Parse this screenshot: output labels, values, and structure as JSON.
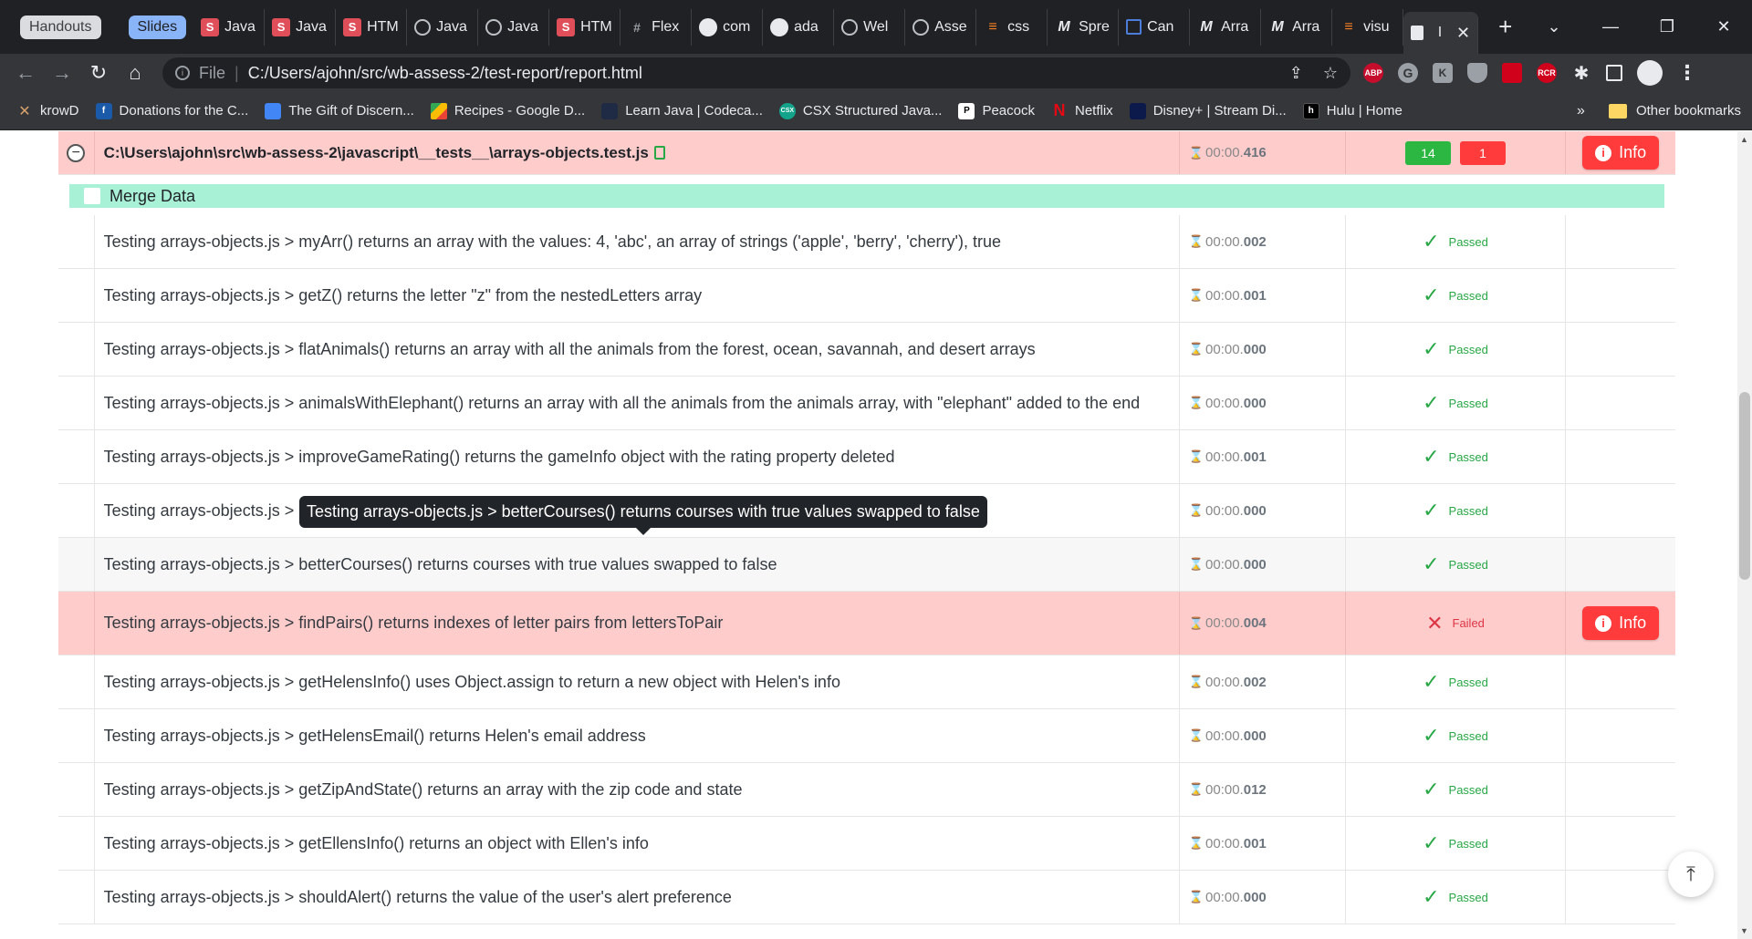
{
  "browser": {
    "tab_groups": [
      "Handouts",
      "Slides"
    ],
    "tabs": [
      {
        "icon": "s-icon",
        "label": "Java"
      },
      {
        "icon": "s-icon",
        "label": "Java"
      },
      {
        "icon": "s-icon",
        "label": "HTM"
      },
      {
        "icon": "globe-icon",
        "label": "Java"
      },
      {
        "icon": "globe-icon",
        "label": "Java"
      },
      {
        "icon": "s-icon",
        "label": "HTM"
      },
      {
        "icon": "flex-icon",
        "label": "Flex"
      },
      {
        "icon": "github-icon",
        "label": "com"
      },
      {
        "icon": "github-icon",
        "label": "ada"
      },
      {
        "icon": "globe-icon",
        "label": "Wel"
      },
      {
        "icon": "globe-icon",
        "label": "Asse"
      },
      {
        "icon": "stackoverflow-icon",
        "label": "css"
      },
      {
        "icon": "mdn-icon",
        "label": "Spre"
      },
      {
        "icon": "canvas-icon",
        "label": "Can"
      },
      {
        "icon": "mdn-icon",
        "label": "Arra"
      },
      {
        "icon": "mdn-icon",
        "label": "Arra"
      },
      {
        "icon": "stackoverflow-icon",
        "label": "visu"
      }
    ],
    "active_tab_label": "I",
    "new_tab_symbol": "+",
    "url_scheme": "File",
    "url": "C:/Users/ajohn/src/wb-assess-2/test-report/report.html",
    "extensions": [
      "ABP",
      "G",
      "K",
      "",
      "",
      "RCR"
    ],
    "bookmarks": [
      {
        "label": "krowD",
        "icon": "c1"
      },
      {
        "label": "Donations for the C...",
        "icon": "c2"
      },
      {
        "label": "The Gift of Discern...",
        "icon": "c3"
      },
      {
        "label": "Recipes - Google D...",
        "icon": "c4"
      },
      {
        "label": "Learn Java | Codeca...",
        "icon": "c5"
      },
      {
        "label": "CSX Structured Java...",
        "icon": "c6"
      },
      {
        "label": "Peacock",
        "icon": "c7"
      },
      {
        "label": "Netflix",
        "icon": "c8"
      },
      {
        "label": "Disney+ | Stream Di...",
        "icon": "c9"
      },
      {
        "label": "Hulu | Home",
        "icon": "c10"
      }
    ],
    "bookmarks_overflow": "»",
    "other_bookmarks": "Other bookmarks"
  },
  "report": {
    "file": {
      "path": "C:\\Users\\ajohn\\src\\wb-assess-2\\javascript\\__tests__\\arrays-objects.test.js",
      "duration_prefix": "00:00.",
      "duration_ms": "416",
      "passed_count": "14",
      "failed_count": "1",
      "info_label": "Info"
    },
    "group_title": "Merge Data",
    "tests": [
      {
        "name": "Testing arrays-objects.js > myArr() returns an array with the values: 4, 'abc', an array of strings ('apple', 'berry', 'cherry'), true",
        "dur_prefix": "00:00.",
        "dur_ms": "002",
        "status": "Passed"
      },
      {
        "name": "Testing arrays-objects.js > getZ() returns the letter \"z\" from the nestedLetters array",
        "dur_prefix": "00:00.",
        "dur_ms": "001",
        "status": "Passed"
      },
      {
        "name": "Testing arrays-objects.js > flatAnimals() returns an array with all the animals from the forest, ocean, savannah, and desert arrays",
        "dur_prefix": "00:00.",
        "dur_ms": "000",
        "status": "Passed"
      },
      {
        "name": "Testing arrays-objects.js > animalsWithElephant() returns an array with all the animals from the animals array, with \"elephant\" added to the end",
        "dur_prefix": "00:00.",
        "dur_ms": "000",
        "status": "Passed"
      },
      {
        "name": "Testing arrays-objects.js > improveGameRating() returns the gameInfo object with the rating property deleted",
        "dur_prefix": "00:00.",
        "dur_ms": "001",
        "status": "Passed"
      },
      {
        "name": "Testing arrays-objects.js > e",
        "dur_prefix": "00:00.",
        "dur_ms": "000",
        "status": "Passed"
      },
      {
        "name": "Testing arrays-objects.js > betterCourses() returns courses with true values swapped to false",
        "dur_prefix": "00:00.",
        "dur_ms": "000",
        "status": "Passed"
      },
      {
        "name": "Testing arrays-objects.js > findPairs() returns indexes of letter pairs from lettersToPair",
        "dur_prefix": "00:00.",
        "dur_ms": "004",
        "status": "Failed",
        "info_label": "Info"
      },
      {
        "name": "Testing arrays-objects.js > getHelensInfo() uses Object.assign to return a new object with Helen's info",
        "dur_prefix": "00:00.",
        "dur_ms": "002",
        "status": "Passed"
      },
      {
        "name": "Testing arrays-objects.js > getHelensEmail() returns Helen's email address",
        "dur_prefix": "00:00.",
        "dur_ms": "000",
        "status": "Passed"
      },
      {
        "name": "Testing arrays-objects.js > getZipAndState() returns an array with the zip code and state",
        "dur_prefix": "00:00.",
        "dur_ms": "012",
        "status": "Passed"
      },
      {
        "name": "Testing arrays-objects.js > getEllensInfo() returns an object with Ellen's info",
        "dur_prefix": "00:00.",
        "dur_ms": "001",
        "status": "Passed"
      },
      {
        "name": "Testing arrays-objects.js > shouldAlert() returns the value of the user's alert preference",
        "dur_prefix": "00:00.",
        "dur_ms": "000",
        "status": "Passed"
      }
    ],
    "tooltip": "Testing arrays-objects.js > betterCourses() returns courses with true values swapped to false"
  },
  "colors": {
    "fail_bg": "#ffcccc",
    "pass": "#28a745",
    "fail": "#dc3545",
    "group_bg": "#a8f0d6",
    "info_button": "#ff3b3b"
  }
}
